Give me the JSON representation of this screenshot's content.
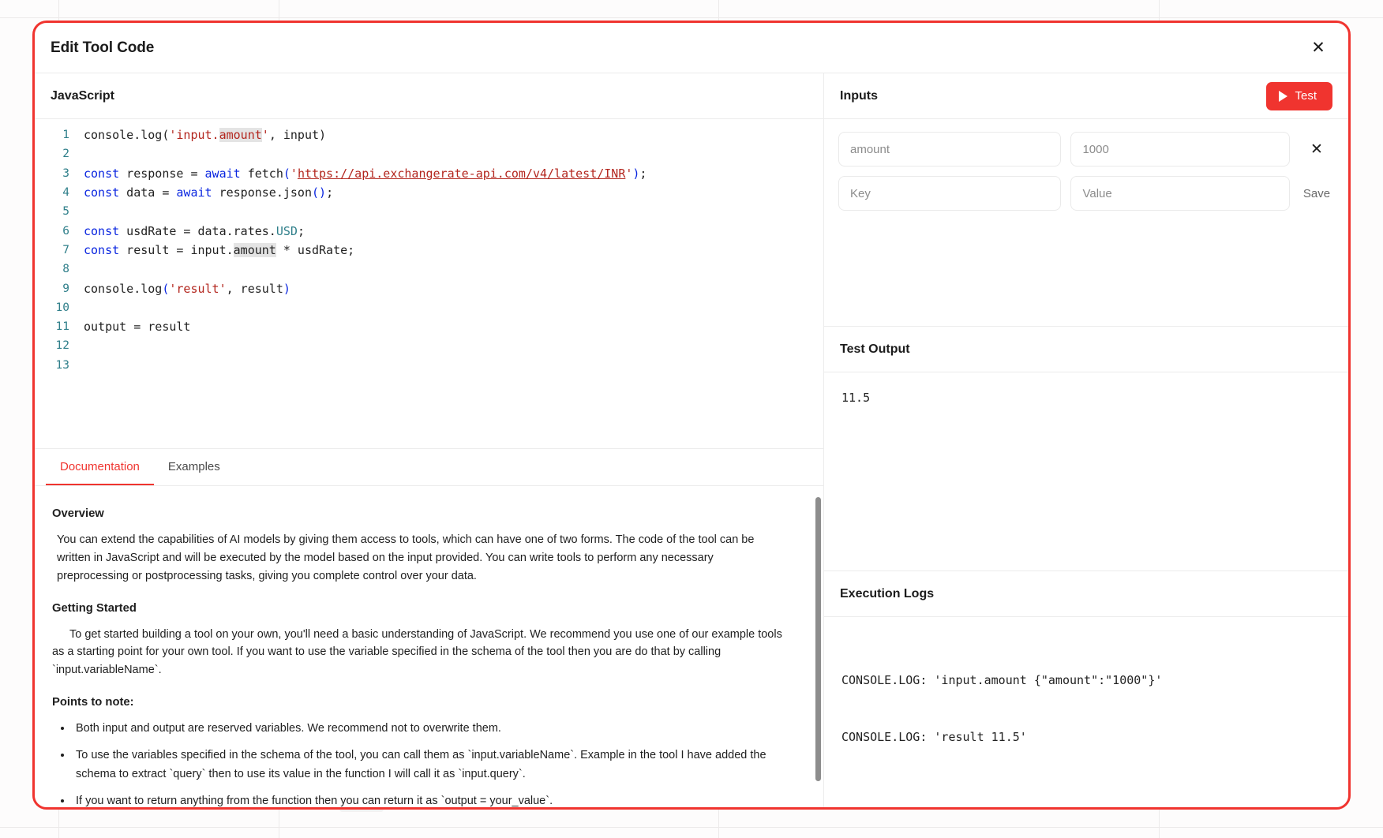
{
  "modal": {
    "title": "Edit Tool Code",
    "close_icon": "close-icon",
    "accent_color": "#f0342f"
  },
  "editor": {
    "title": "JavaScript",
    "language": "JavaScript",
    "lines": [
      {
        "n": "1",
        "text": "console.log('input.amount', input)"
      },
      {
        "n": "2",
        "text": ""
      },
      {
        "n": "3",
        "text": "const response = await fetch('https://api.exchangerate-api.com/v4/latest/INR');"
      },
      {
        "n": "4",
        "text": "const data = await response.json();"
      },
      {
        "n": "5",
        "text": ""
      },
      {
        "n": "6",
        "text": "const usdRate = data.rates.USD;"
      },
      {
        "n": "7",
        "text": "const result = input.amount * usdRate;"
      },
      {
        "n": "8",
        "text": ""
      },
      {
        "n": "9",
        "text": "console.log('result', result)"
      },
      {
        "n": "10",
        "text": ""
      },
      {
        "n": "11",
        "text": "output = result"
      },
      {
        "n": "12",
        "text": ""
      },
      {
        "n": "13",
        "text": ""
      }
    ]
  },
  "tabs": [
    {
      "label": "Documentation",
      "active": true
    },
    {
      "label": "Examples",
      "active": false
    }
  ],
  "documentation": {
    "overview_heading": "Overview",
    "overview_body": "You can extend the capabilities of AI models by giving them access to tools, which can have one of two forms. The code of the tool can be written in JavaScript and will be executed by the model based on the input provided. You can write tools to perform any necessary preprocessing or postprocessing tasks, giving you complete control over your data.",
    "getting_started_heading": "Getting Started",
    "getting_started_body": "To get started building a tool on your own, you'll need a basic understanding of JavaScript. We recommend you use one of our example tools as a starting point for your own tool. If you want to use the variable specified in the schema of the tool then you are do that by calling `input.variableName`.",
    "points_heading": "Points to note:",
    "points": [
      "Both input and output are reserved variables. We recommend not to overwrite them.",
      "To use the variables specified in the schema of the tool, you can call them as `input.variableName`. Example in the tool I have added the schema to extract `query` then to use its value in the function I will call it as `input.query`.",
      "If you want to return anything from the function then you can return it as `output = your_value`."
    ]
  },
  "inputs": {
    "title": "Inputs",
    "test_button": "Test",
    "play_icon": "play-icon",
    "rows": [
      {
        "key": "amount",
        "value": "1000",
        "remove_icon": "close-icon"
      }
    ],
    "new_row": {
      "key_placeholder": "Key",
      "value_placeholder": "Value",
      "key_value": "",
      "value_value": "",
      "save_label": "Save"
    }
  },
  "test_output": {
    "title": "Test Output",
    "value": "11.5"
  },
  "execution_logs": {
    "title": "Execution Logs",
    "lines": [
      "CONSOLE.LOG: 'input.amount {\"amount\":\"1000\"}'",
      "CONSOLE.LOG: 'result 11.5'"
    ]
  }
}
